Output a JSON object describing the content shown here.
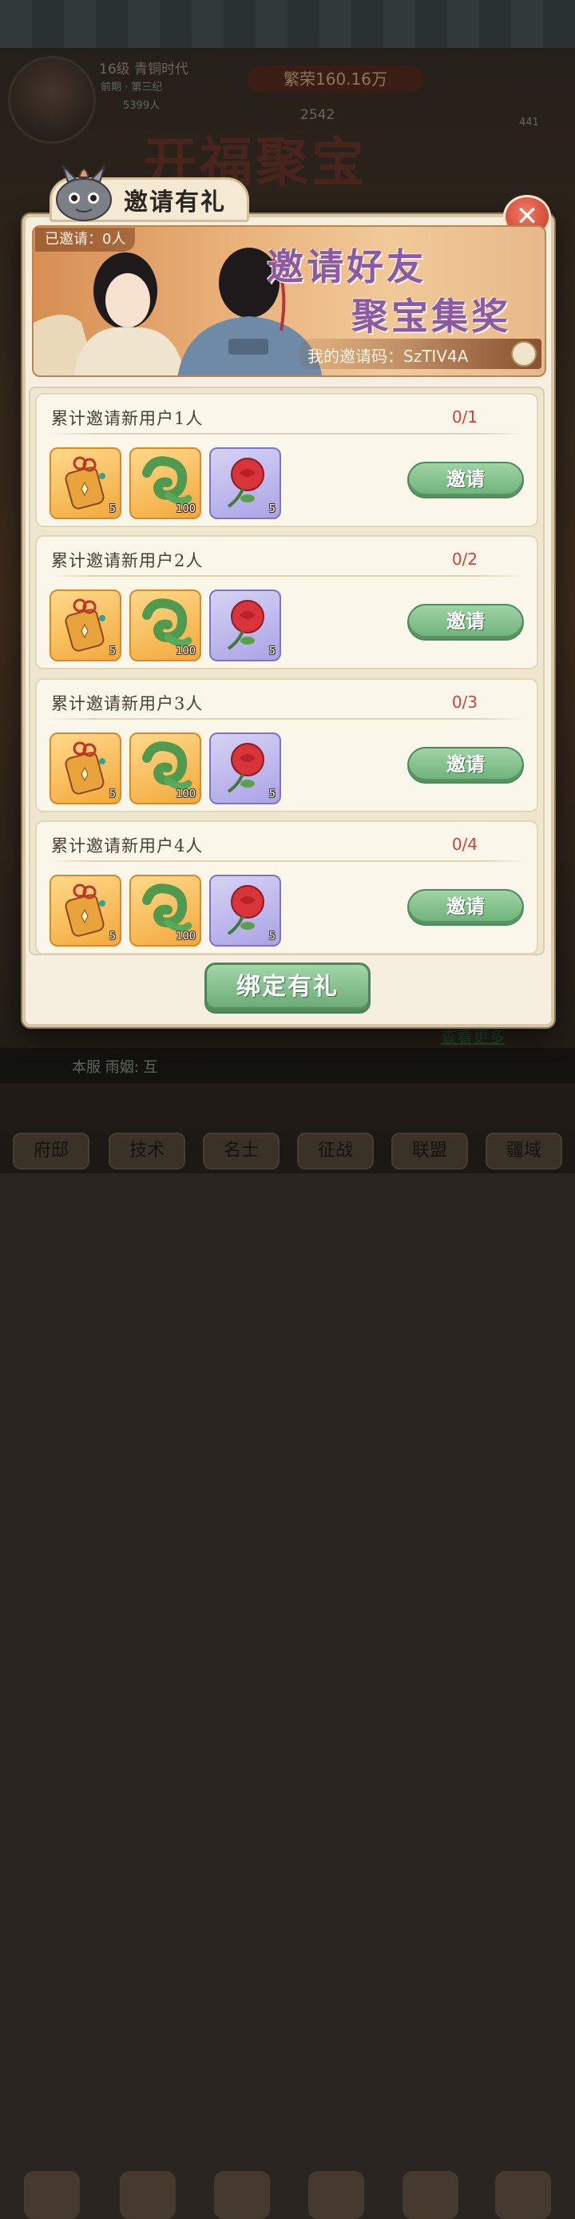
{
  "background": {
    "player_level": "16级 青铜时代",
    "era": "前期 · 第三纪",
    "population": "5399人",
    "wealth": "繁荣160.16万",
    "resource_a": "2542",
    "resource_b": "441",
    "event_title": "开福聚宝",
    "see_more": "查看更多",
    "notice": "本服 雨姻: 互",
    "nav": [
      "府邸",
      "技术",
      "名士",
      "征战",
      "联盟",
      "疆域"
    ]
  },
  "modal": {
    "title": "邀请有礼",
    "invited_count": "已邀请：0人",
    "banner_line1": "邀请好友",
    "banner_line2": "聚宝集奖",
    "invite_code": "我的邀请码：SzTIV4A",
    "tasks": [
      {
        "title": "累计邀请新用户1人",
        "progress": "0/1",
        "button": "邀请",
        "rewards": [
          "5",
          "100",
          "5"
        ]
      },
      {
        "title": "累计邀请新用户2人",
        "progress": "0/2",
        "button": "邀请",
        "rewards": [
          "5",
          "100",
          "5"
        ]
      },
      {
        "title": "累计邀请新用户3人",
        "progress": "0/3",
        "button": "邀请",
        "rewards": [
          "5",
          "100",
          "5"
        ]
      },
      {
        "title": "累计邀请新用户4人",
        "progress": "0/4",
        "button": "邀请",
        "rewards": [
          "5",
          "100",
          "5"
        ]
      }
    ],
    "bind_button": "绑定有礼",
    "reward_icons": [
      "pouch-icon",
      "jade-dragon-icon",
      "rose-icon"
    ],
    "colors": {
      "progress": "#d2443a",
      "button_green": "#6db07a",
      "banner_text": "#8b5aa5"
    }
  }
}
